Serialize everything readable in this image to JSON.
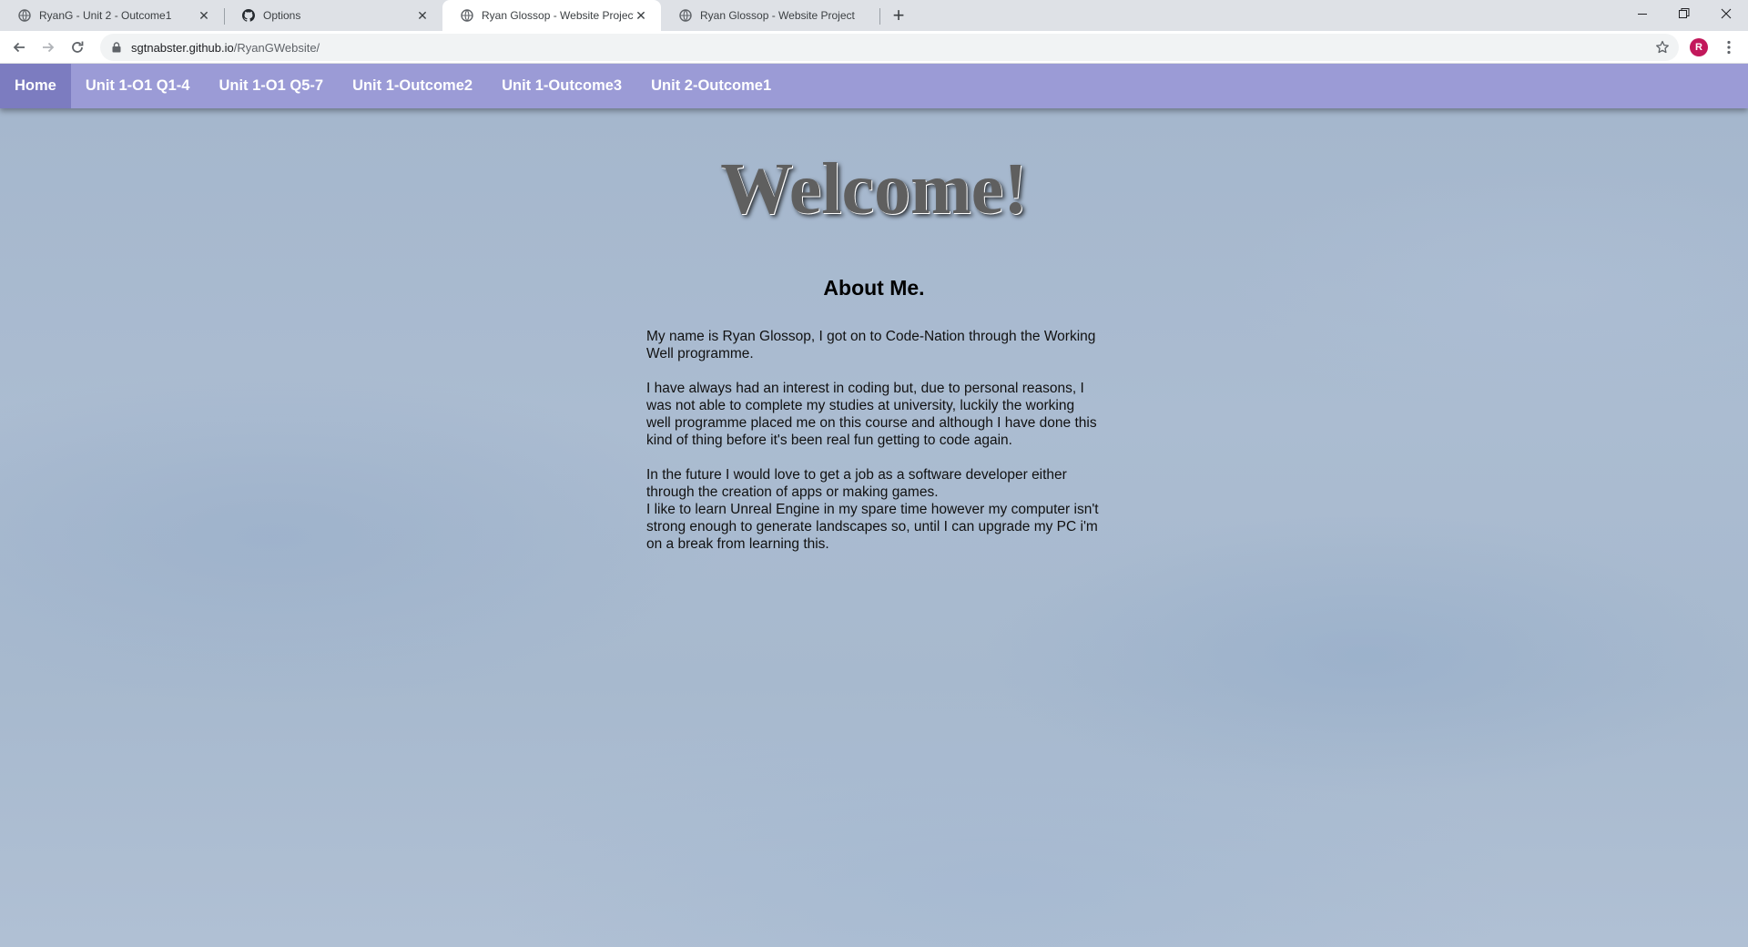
{
  "browser": {
    "tabs": [
      {
        "title": "RyanG - Unit 2 - Outcome1",
        "icon": "globe-icon",
        "active": false
      },
      {
        "title": "Options",
        "icon": "github-icon",
        "active": false
      },
      {
        "title": "Ryan Glossop - Website Project",
        "icon": "globe-icon",
        "active": true
      },
      {
        "title": "Ryan Glossop - Website Project",
        "icon": "globe-icon",
        "active": false
      }
    ],
    "new_tab": "+",
    "address": {
      "host": "sgtnabster.github.io",
      "path": "/RyanGWebsite/"
    },
    "profile_initial": "R",
    "profile_color": "#c2185b"
  },
  "site": {
    "nav": [
      {
        "label": "Home",
        "active": true
      },
      {
        "label": "Unit 1-O1 Q1-4",
        "active": false
      },
      {
        "label": "Unit 1-O1 Q5-7",
        "active": false
      },
      {
        "label": "Unit 1-Outcome2",
        "active": false
      },
      {
        "label": "Unit 1-Outcome3",
        "active": false
      },
      {
        "label": "Unit 2-Outcome1",
        "active": false
      }
    ],
    "nav_color": "#9b9bd6",
    "welcome": "Welcome!",
    "about_heading": "About Me.",
    "paragraphs": [
      "My name is Ryan Glossop, I got on to Code-Nation through the Working Well programme.",
      "I have always had an interest in coding but, due to personal reasons, I was not able to complete my studies at university, luckily the working well programme placed me on this course and although I have done this kind of thing before it's been real fun getting to code again.",
      "In the future I would love to get a job as a software developer either through the creation of apps or making games.",
      "I like to learn Unreal Engine in my spare time however my computer isn't strong enough to generate landscapes so, until I can upgrade my PC i'm on a break from learning this."
    ]
  }
}
